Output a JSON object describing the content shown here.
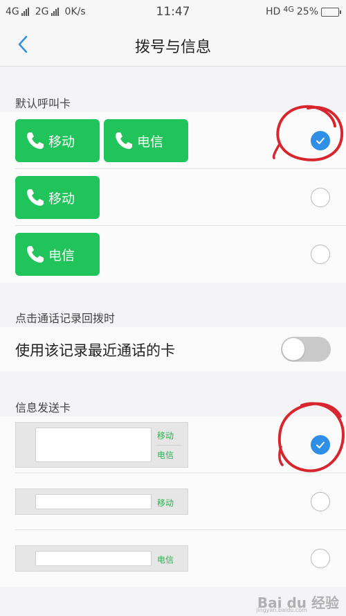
{
  "status_bar": {
    "network_1": "4G",
    "network_2": "2G",
    "speed": "0K/s",
    "time": "11:47",
    "hd": "HD",
    "net_right": "4G",
    "battery": "25%",
    "battery_level": 0.25
  },
  "nav": {
    "back_icon": "chevron-left-icon",
    "title": "拨号与信息"
  },
  "default_call": {
    "header": "默认呼叫卡",
    "options": [
      {
        "buttons": [
          "移动",
          "电信"
        ],
        "selected": true
      },
      {
        "buttons": [
          "移动"
        ],
        "selected": false
      },
      {
        "buttons": [
          "电信"
        ],
        "selected": false
      }
    ]
  },
  "redial": {
    "header": "点击通话记录回拨时",
    "label": "使用该记录最近通话的卡",
    "enabled": false
  },
  "message_card": {
    "header": "信息发送卡",
    "options": [
      {
        "labels": [
          "移动",
          "电信"
        ],
        "selected": true
      },
      {
        "labels": [
          "移动"
        ],
        "selected": false
      },
      {
        "labels": [
          "电信"
        ],
        "selected": false
      }
    ]
  },
  "watermark": {
    "brand": "Bai du 经验",
    "url": "jingyan.baidu.com"
  },
  "colors": {
    "accent_blue": "#2f8ee5",
    "sim_green": "#21c45a",
    "annotation_red": "#d8262e"
  }
}
